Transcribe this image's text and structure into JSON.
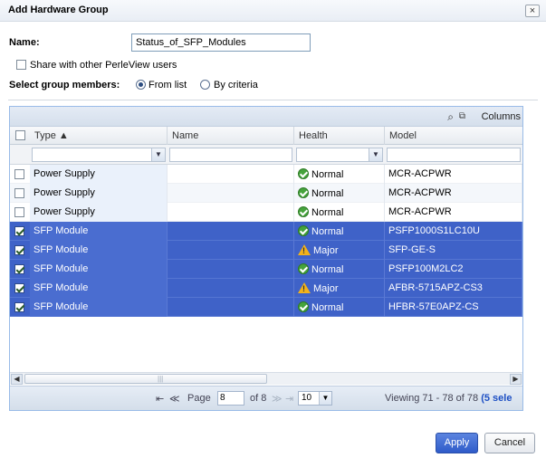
{
  "dialog": {
    "title": "Add Hardware Group",
    "close_glyph": "×"
  },
  "form": {
    "name_label": "Name:",
    "name_value": "Status_of_SFP_Modules",
    "share_label": "Share with other PerleView users",
    "share_checked": false,
    "members_label": "Select group members:",
    "from_list_label": "From list",
    "by_criteria_label": "By criteria",
    "selected_mode": "From list"
  },
  "grid": {
    "toolbar": {
      "columns_label": "Columns"
    },
    "columns": [
      "Type ▲",
      "Name",
      "Health",
      "Model"
    ],
    "rows": [
      {
        "type": "Power Supply",
        "name": "",
        "health": "Normal",
        "health_icon": "ok-icon",
        "model": "MCR-ACPWR",
        "selected": false
      },
      {
        "type": "Power Supply",
        "name": "",
        "health": "Normal",
        "health_icon": "ok-icon",
        "model": "MCR-ACPWR",
        "selected": false
      },
      {
        "type": "Power Supply",
        "name": "",
        "health": "Normal",
        "health_icon": "ok-icon",
        "model": "MCR-ACPWR",
        "selected": false
      },
      {
        "type": "SFP Module",
        "name": "",
        "health": "Normal",
        "health_icon": "ok-icon",
        "model": "PSFP1000S1LC10U",
        "selected": true
      },
      {
        "type": "SFP Module",
        "name": "",
        "health": "Major",
        "health_icon": "warning-icon",
        "model": "SFP-GE-S",
        "selected": true
      },
      {
        "type": "SFP Module",
        "name": "",
        "health": "Normal",
        "health_icon": "ok-icon",
        "model": "PSFP100M2LC2",
        "selected": true
      },
      {
        "type": "SFP Module",
        "name": "",
        "health": "Major",
        "health_icon": "warning-icon",
        "model": "AFBR-5715APZ-CS3",
        "selected": true
      },
      {
        "type": "SFP Module",
        "name": "",
        "health": "Normal",
        "health_icon": "ok-icon",
        "model": "HFBR-57E0APZ-CS",
        "selected": true
      }
    ],
    "pager": {
      "page_label": "Page",
      "page_value": "8",
      "of_label": "of 8",
      "page_size": "10",
      "viewing_text": "Viewing 71 - 78 of 78",
      "selected_text": "(5 sele"
    }
  },
  "buttons": {
    "apply": "Apply",
    "cancel": "Cancel"
  },
  "colors": {
    "selection": "#3f62c8",
    "ok": "#46a33c",
    "warning": "#f2b21a",
    "apply_button": "#3a66d3"
  }
}
